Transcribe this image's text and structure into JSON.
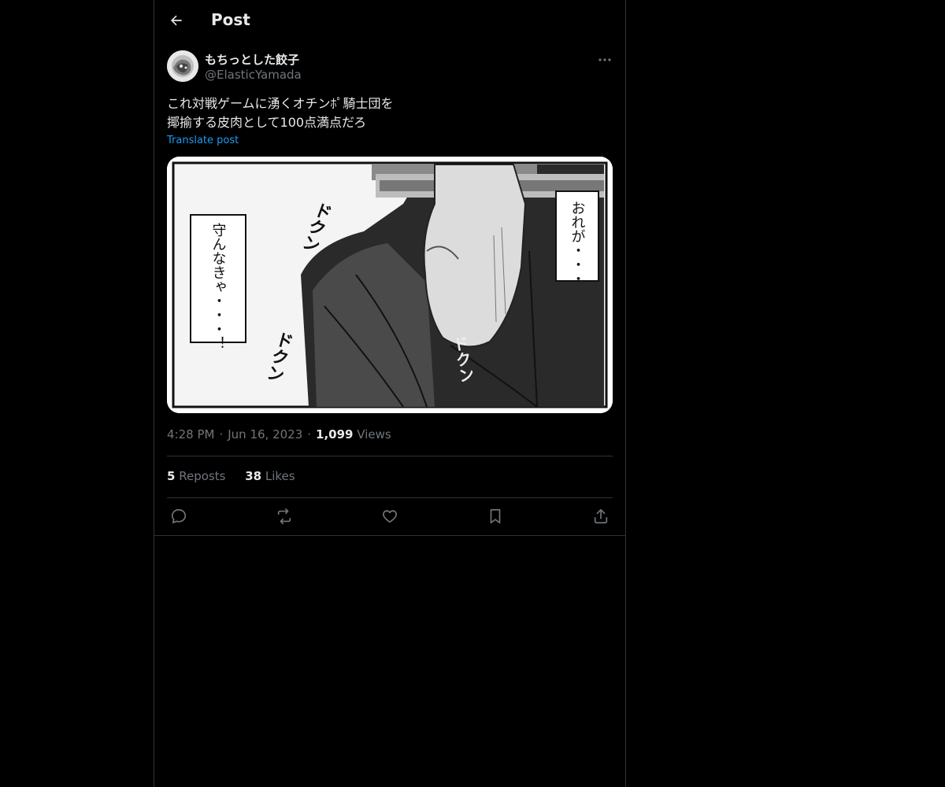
{
  "header": {
    "title": "Post",
    "back_icon": "arrow-left-icon"
  },
  "author": {
    "display_name": "もちっとした餃子",
    "handle": "@ElasticYamada",
    "more_icon": "more-horizontal-icon"
  },
  "post": {
    "text_lines": [
      "これ対戦ゲームに湧くオチンﾎﾟ騎士団を",
      "揶揄する皮肉として100点満点だろ"
    ],
    "translate_label": "Translate post",
    "image": {
      "caption_right": "おれが・・・",
      "caption_left": "守んなきゃ・・・！",
      "sfx": [
        "ドクン",
        "ドクン",
        "ドクン"
      ]
    }
  },
  "meta": {
    "time": "4:28 PM",
    "date": "Jun 16, 2023",
    "views_count": "1,099",
    "views_label": "Views",
    "separator": "·"
  },
  "stats": {
    "reposts_count": "5",
    "reposts_label": "Reposts",
    "likes_count": "38",
    "likes_label": "Likes"
  },
  "actions": [
    {
      "name": "reply",
      "icon": "reply-icon"
    },
    {
      "name": "repost",
      "icon": "repost-icon"
    },
    {
      "name": "like",
      "icon": "heart-icon"
    },
    {
      "name": "bookmark",
      "icon": "bookmark-icon"
    },
    {
      "name": "share",
      "icon": "share-icon"
    }
  ],
  "colors": {
    "background": "#000000",
    "text_primary": "#e7e9ea",
    "text_secondary": "#71767b",
    "link": "#1d9bf0",
    "border": "#2f3336"
  }
}
